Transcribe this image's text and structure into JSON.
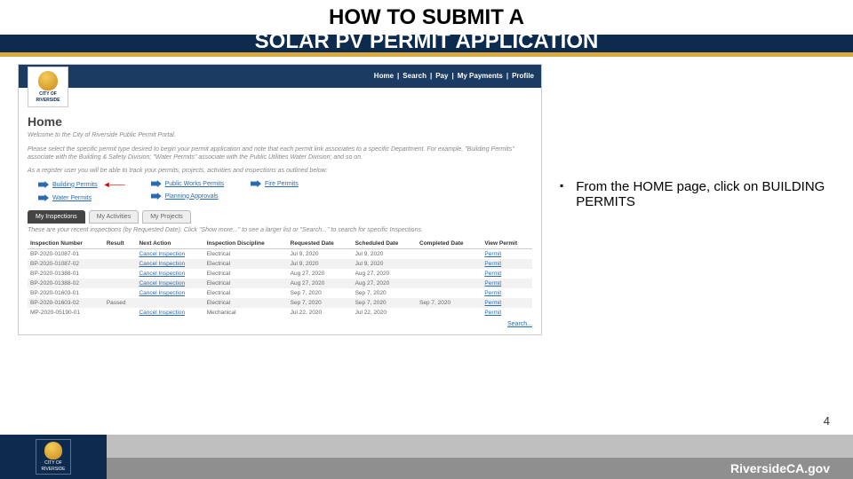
{
  "slide": {
    "title_line1": "HOW TO SUBMIT A",
    "title_line2": "SOLAR PV PERMIT APPLICATION",
    "page_number": "4",
    "footer_url": "RiversideCA.gov",
    "logo_text": "RIVERSIDE",
    "logo_city": "CITY OF"
  },
  "instruction": {
    "bullet": "▪",
    "text": "From the HOME page, click on BUILDING PERMITS"
  },
  "portal": {
    "nav": [
      "Home",
      "|",
      "Search",
      "|",
      "Pay",
      "|",
      "My Payments",
      "|",
      "Profile"
    ],
    "heading": "Home",
    "welcome": "Welcome to the City of Riverside Public Permit Portal.",
    "desc1": "Please select the specific permit type desired to begin your permit application and note that each permit link associates to a specific Department. For example, \"Building Permits\" associate with the Building & Safety Division; \"Water Permits\" associate with the Public Utilities Water Division; and so on.",
    "desc2": "As a register user you will be able to track your permits, projects, activities and inspections as outlined below:",
    "links": {
      "building": "Building Permits",
      "water": "Water Permits",
      "public_works": "Public Works Permits",
      "planning": "Planning Approvals",
      "fire": "Fire Permits"
    },
    "tabs": [
      "My Inspections",
      "My Activities",
      "My Projects"
    ],
    "tab_desc": "These are your recent inspections (by Requested Date). Click \"Show more...\" to see a larger list or \"Search...\" to search for specific Inspections.",
    "columns": [
      "Inspection Number",
      "Result",
      "Next Action",
      "Inspection Discipline",
      "Requested Date",
      "Scheduled Date",
      "Completed Date",
      "View Permit"
    ],
    "rows": [
      {
        "num": "BP-2020-01087-01",
        "result": "",
        "action": "Cancel Inspection",
        "disc": "Electrical",
        "req": "Jul 9, 2020",
        "sch": "Jul 9, 2020",
        "comp": "",
        "permit": "Permit"
      },
      {
        "num": "BP-2020-01087-02",
        "result": "",
        "action": "Cancel Inspection",
        "disc": "Electrical",
        "req": "Jul 9, 2020",
        "sch": "Jul 9, 2020",
        "comp": "",
        "permit": "Permit"
      },
      {
        "num": "BP-2020-01388-01",
        "result": "",
        "action": "Cancel Inspection",
        "disc": "Electrical",
        "req": "Aug 27, 2020",
        "sch": "Aug 27, 2020",
        "comp": "",
        "permit": "Permit"
      },
      {
        "num": "BP-2020-01388-02",
        "result": "",
        "action": "Cancel Inspection",
        "disc": "Electrical",
        "req": "Aug 27, 2020",
        "sch": "Aug 27, 2020",
        "comp": "",
        "permit": "Permit"
      },
      {
        "num": "BP-2020-01603-01",
        "result": "",
        "action": "Cancel Inspection",
        "disc": "Electrical",
        "req": "Sep 7, 2020",
        "sch": "Sep 7, 2020",
        "comp": "",
        "permit": "Permit"
      },
      {
        "num": "BP-2020-01603-02",
        "result": "Passed",
        "action": "",
        "disc": "Electrical",
        "req": "Sep 7, 2020",
        "sch": "Sep 7, 2020",
        "comp": "Sep 7, 2020",
        "permit": "Permit"
      },
      {
        "num": "MP-2020-05190-01",
        "result": "",
        "action": "Cancel Inspection",
        "disc": "Mechanical",
        "req": "Jul 22, 2020",
        "sch": "Jul 22, 2020",
        "comp": "",
        "permit": "Permit"
      }
    ],
    "search": "Search..."
  }
}
